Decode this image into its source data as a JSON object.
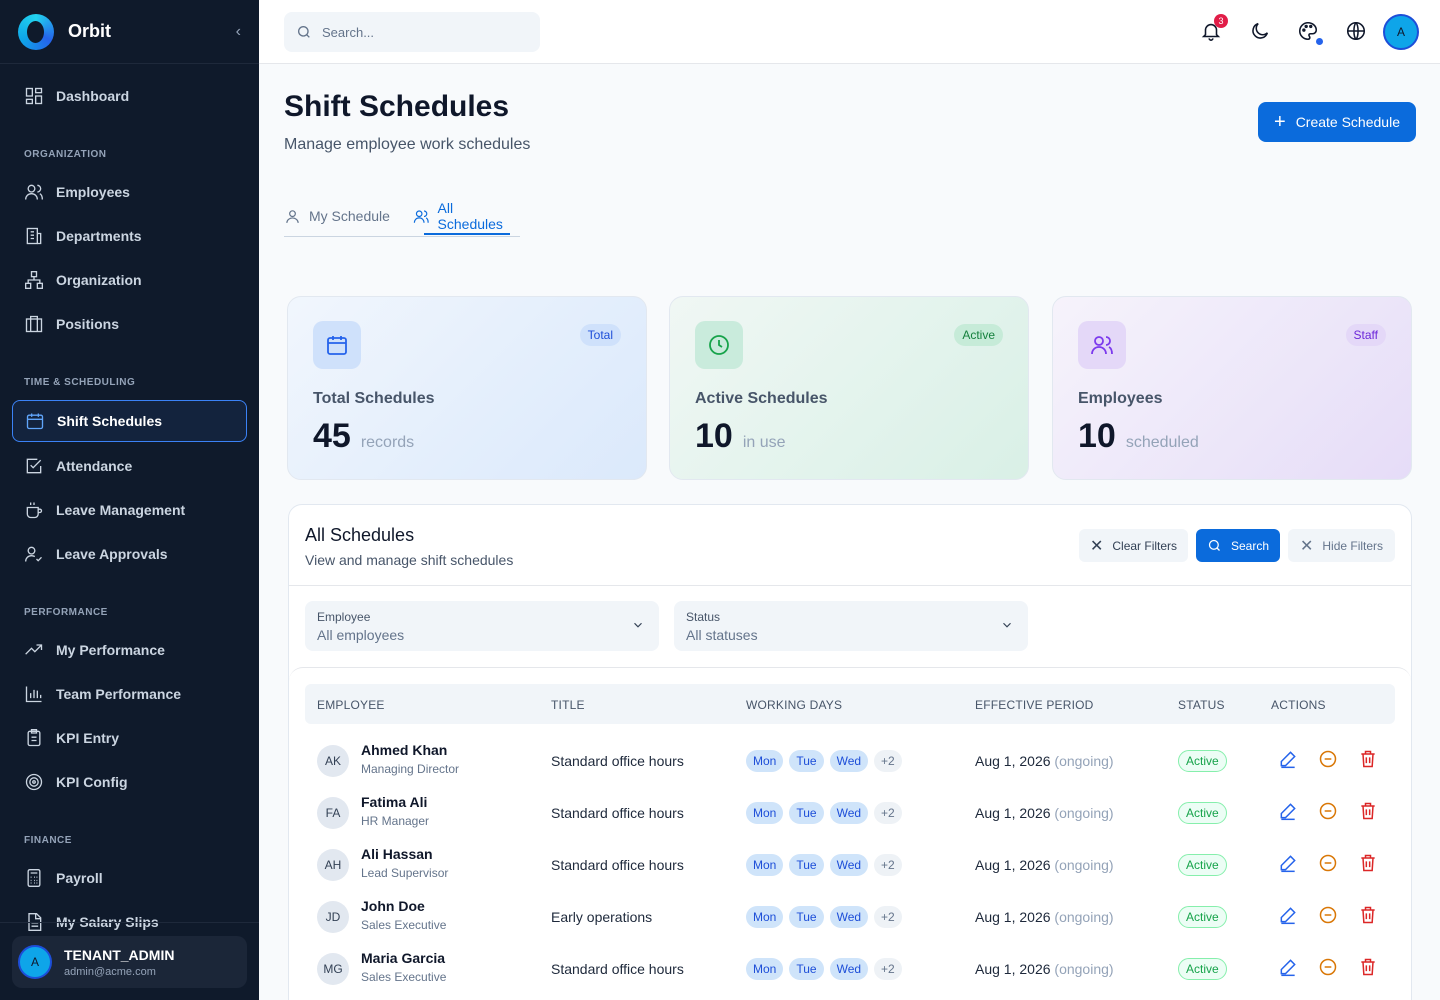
{
  "app": {
    "name": "Orbit",
    "collapse_icon": "chevron-left-icon"
  },
  "sidebar": {
    "dashboard": "Dashboard",
    "sections": {
      "organization": "ORGANIZATION",
      "time": "TIME & SCHEDULING",
      "performance": "PERFORMANCE",
      "finance": "FINANCE"
    },
    "items": {
      "employees": "Employees",
      "departments": "Departments",
      "organization": "Organization",
      "positions": "Positions",
      "shift_schedules": "Shift Schedules",
      "attendance": "Attendance",
      "leave_management": "Leave Management",
      "leave_approvals": "Leave Approvals",
      "my_performance": "My Performance",
      "team_performance": "Team Performance",
      "kpi_entry": "KPI Entry",
      "kpi_config": "KPI Config",
      "payroll": "Payroll",
      "my_salary_slips": "My Salary Slips"
    },
    "user": {
      "initial": "A",
      "name": "TENANT_ADMIN",
      "email": "admin@acme.com"
    }
  },
  "topbar": {
    "search_placeholder": "Search...",
    "notification_count": "3",
    "avatar_initial": "A"
  },
  "page": {
    "title": "Shift Schedules",
    "subtitle": "Manage employee work schedules",
    "create_button": "Create Schedule",
    "tabs": {
      "my": "My Schedule",
      "all": "All Schedules"
    }
  },
  "stats": {
    "total": {
      "badge": "Total",
      "label": "Total Schedules",
      "value": "45",
      "unit": "records"
    },
    "active": {
      "badge": "Active",
      "label": "Active Schedules",
      "value": "10",
      "unit": "in use"
    },
    "employees": {
      "badge": "Staff",
      "label": "Employees",
      "value": "10",
      "unit": "scheduled"
    }
  },
  "panel": {
    "title": "All Schedules",
    "subtitle": "View and manage shift schedules",
    "buttons": {
      "clear": "Clear Filters",
      "search": "Search",
      "hide": "Hide Filters"
    },
    "filters": {
      "employee": {
        "label": "Employee",
        "value": "All employees"
      },
      "status": {
        "label": "Status",
        "value": "All statuses"
      }
    },
    "columns": {
      "employee": "EMPLOYEE",
      "title": "TITLE",
      "working_days": "WORKING DAYS",
      "effective_period": "EFFECTIVE PERIOD",
      "status": "STATUS",
      "actions": "ACTIONS"
    },
    "rows": [
      {
        "initials": "AK",
        "name": "Ahmed Khan",
        "role": "Managing Director",
        "title": "Standard office hours",
        "days": [
          "Mon",
          "Tue",
          "Wed"
        ],
        "more": "+2",
        "period": "Aug 1, 2026",
        "ongoing": "(ongoing)",
        "status": "Active"
      },
      {
        "initials": "FA",
        "name": "Fatima Ali",
        "role": "HR Manager",
        "title": "Standard office hours",
        "days": [
          "Mon",
          "Tue",
          "Wed"
        ],
        "more": "+2",
        "period": "Aug 1, 2026",
        "ongoing": "(ongoing)",
        "status": "Active"
      },
      {
        "initials": "AH",
        "name": "Ali Hassan",
        "role": "Lead Supervisor",
        "title": "Standard office hours",
        "days": [
          "Mon",
          "Tue",
          "Wed"
        ],
        "more": "+2",
        "period": "Aug 1, 2026",
        "ongoing": "(ongoing)",
        "status": "Active"
      },
      {
        "initials": "JD",
        "name": "John Doe",
        "role": "Sales Executive",
        "title": "Early operations",
        "days": [
          "Mon",
          "Tue",
          "Wed"
        ],
        "more": "+2",
        "period": "Aug 1, 2026",
        "ongoing": "(ongoing)",
        "status": "Active"
      },
      {
        "initials": "MG",
        "name": "Maria Garcia",
        "role": "Sales Executive",
        "title": "Standard office hours",
        "days": [
          "Mon",
          "Tue",
          "Wed"
        ],
        "more": "+2",
        "period": "Aug 1, 2026",
        "ongoing": "(ongoing)",
        "status": "Active"
      }
    ]
  },
  "colors": {
    "primary": "#0b6bdc",
    "sidebar_bg": "#0f1a2b",
    "active_green": "#16a34a",
    "danger": "#dc2626",
    "warning": "#d97706"
  }
}
